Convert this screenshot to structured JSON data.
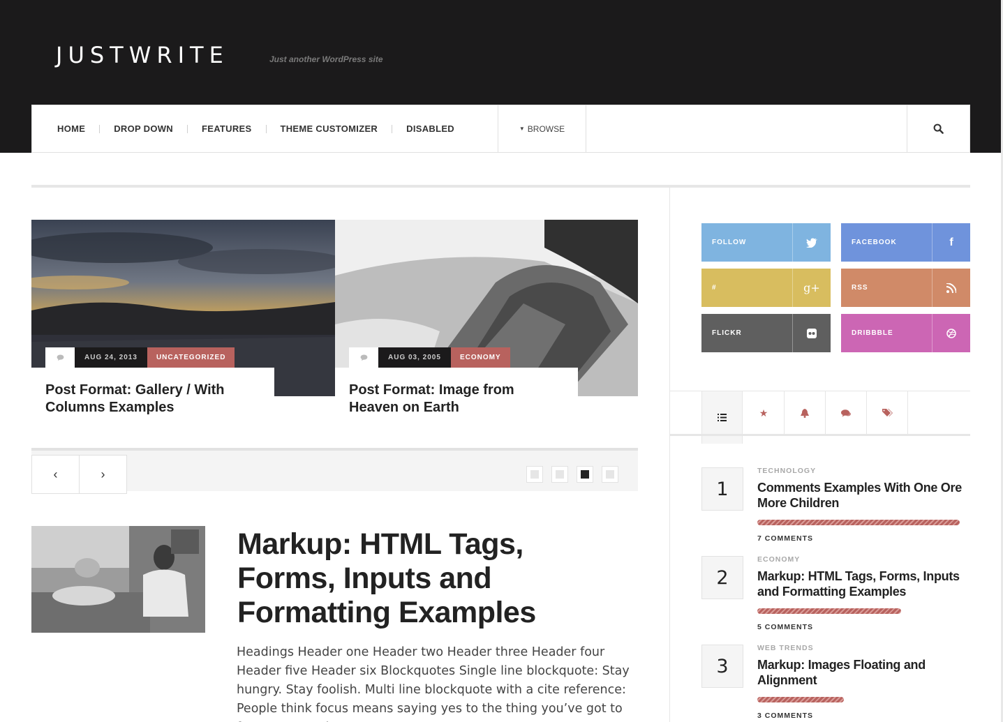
{
  "header": {
    "logo": "JUSTWRITE",
    "tagline": "Just another WordPress site"
  },
  "nav": {
    "items": [
      "HOME",
      "DROP DOWN",
      "FEATURES",
      "THEME CUSTOMIZER",
      "DISABLED"
    ],
    "browse_label": "BROWSE",
    "search_icon": "search-icon"
  },
  "slider": {
    "slides": [
      {
        "date": "AUG 24, 2013",
        "category": "UNCATEGORIZED",
        "title": "Post Format: Gallery / With Columns Examples",
        "category_color": "#b8625e"
      },
      {
        "date": "AUG 03, 2005",
        "category": "ECONOMY",
        "title": "Post Format: Image from Heaven on Earth",
        "category_color": "#b8625e"
      }
    ],
    "prev_icon": "chevron-left-icon",
    "next_icon": "chevron-right-icon",
    "pages": 4,
    "active_page": 3
  },
  "article": {
    "title": "Markup: HTML Tags, Forms, Inputs and Formatting Examples",
    "excerpt": "Headings Header one Header two Header three Header four Header five Header six Blockquotes Single line blockquote: Stay hungry. Stay foolish. Multi line blockquote with a cite reference: People think focus means saying yes to the thing you’ve got to focus on. But that’s"
  },
  "social": [
    {
      "label": "FOLLOW",
      "icon": "twitter-icon",
      "glyph": "🐦",
      "color": "#7fb4e0"
    },
    {
      "label": "FACEBOOK",
      "icon": "facebook-icon",
      "glyph": "f",
      "color": "#6f93dc"
    },
    {
      "label": "#",
      "icon": "google-plus-icon",
      "glyph": "g+",
      "color": "#d8bd5f"
    },
    {
      "label": "RSS",
      "icon": "rss-icon",
      "glyph": "◝",
      "color": "#d08a68"
    },
    {
      "label": "FLICKR",
      "icon": "flickr-icon",
      "glyph": "●●",
      "color": "#5f5f5f"
    },
    {
      "label": "DRIBBBLE",
      "icon": "dribbble-icon",
      "glyph": "◎",
      "color": "#cc66b4"
    }
  ],
  "tabs": [
    "list-icon",
    "star-icon",
    "bell-icon",
    "comments-icon",
    "tags-icon"
  ],
  "popular": [
    {
      "rank": "1",
      "category": "TECHNOLOGY",
      "title": "Comments Examples With One Ore More Children",
      "comments": "7 COMMENTS",
      "bar": 0.97
    },
    {
      "rank": "2",
      "category": "ECONOMY",
      "title": "Markup: HTML Tags, Forms, Inputs and Formatting Examples",
      "comments": "5 COMMENTS",
      "bar": 0.69
    },
    {
      "rank": "3",
      "category": "WEB TRENDS",
      "title": "Markup: Images Floating and Alignment",
      "comments": "3 COMMENTS",
      "bar": 0.41
    }
  ],
  "colors": {
    "header_bg": "#1b1a1b",
    "accent": "#b8625e"
  }
}
